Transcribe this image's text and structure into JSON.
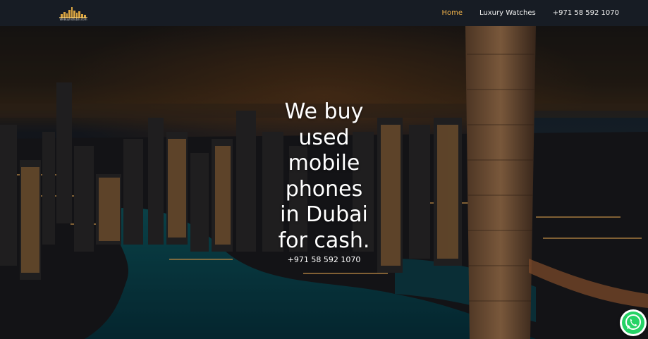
{
  "logo": {
    "text": "WeBuyInDubai.com"
  },
  "nav": {
    "items": [
      {
        "label": "Home"
      },
      {
        "label": "Luxury Watches"
      },
      {
        "label": "+971 58 592 1070"
      }
    ]
  },
  "hero": {
    "title_lines": [
      "We buy",
      "used",
      "mobile",
      "phones",
      "in Dubai",
      "for cash."
    ],
    "phone": "+971 58 592 1070"
  },
  "colors": {
    "navbar_bg": "#171c24",
    "active_link": "#f0b24a",
    "text": "#ffffff",
    "whatsapp": "#25d366"
  },
  "icons": {
    "whatsapp": "whatsapp-icon",
    "logo": "skyline-logo"
  }
}
